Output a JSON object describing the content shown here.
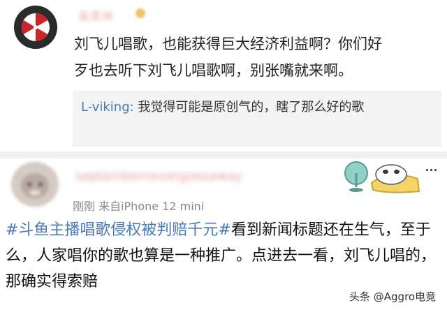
{
  "comment1": {
    "author": "吴思祥",
    "text": "刘飞儿唱歌，也能获得巨大经济利益啊？你们好\n歹也去听下刘飞儿唱歌啊，别张嘴就来啊。",
    "reply": {
      "user": "L-viking:",
      "text": " 我觉得可能是原创气的，瞎了那么好的歌"
    }
  },
  "comment2": {
    "author": "septembernevergoesaway",
    "meta": "刚刚  来自iPhone 12 mini",
    "hashtag": "#斗鱼主播唱歌侵权被判赔千元#",
    "text": "看到新闻标题还在生气，至于么，人家唱你的歌也算是一种推广。点进去一看，刘飞儿唱的，那确实得索赔"
  },
  "watermark": "头条 @Aggro电竞",
  "colors": {
    "link": "#4a7ab8",
    "quote_bg": "#f3f3f3",
    "divider": "#f0f0f0"
  },
  "icons": {
    "avatar1": "umbrella-logo-avatar",
    "sticker": "fan-and-cat-sticker"
  }
}
